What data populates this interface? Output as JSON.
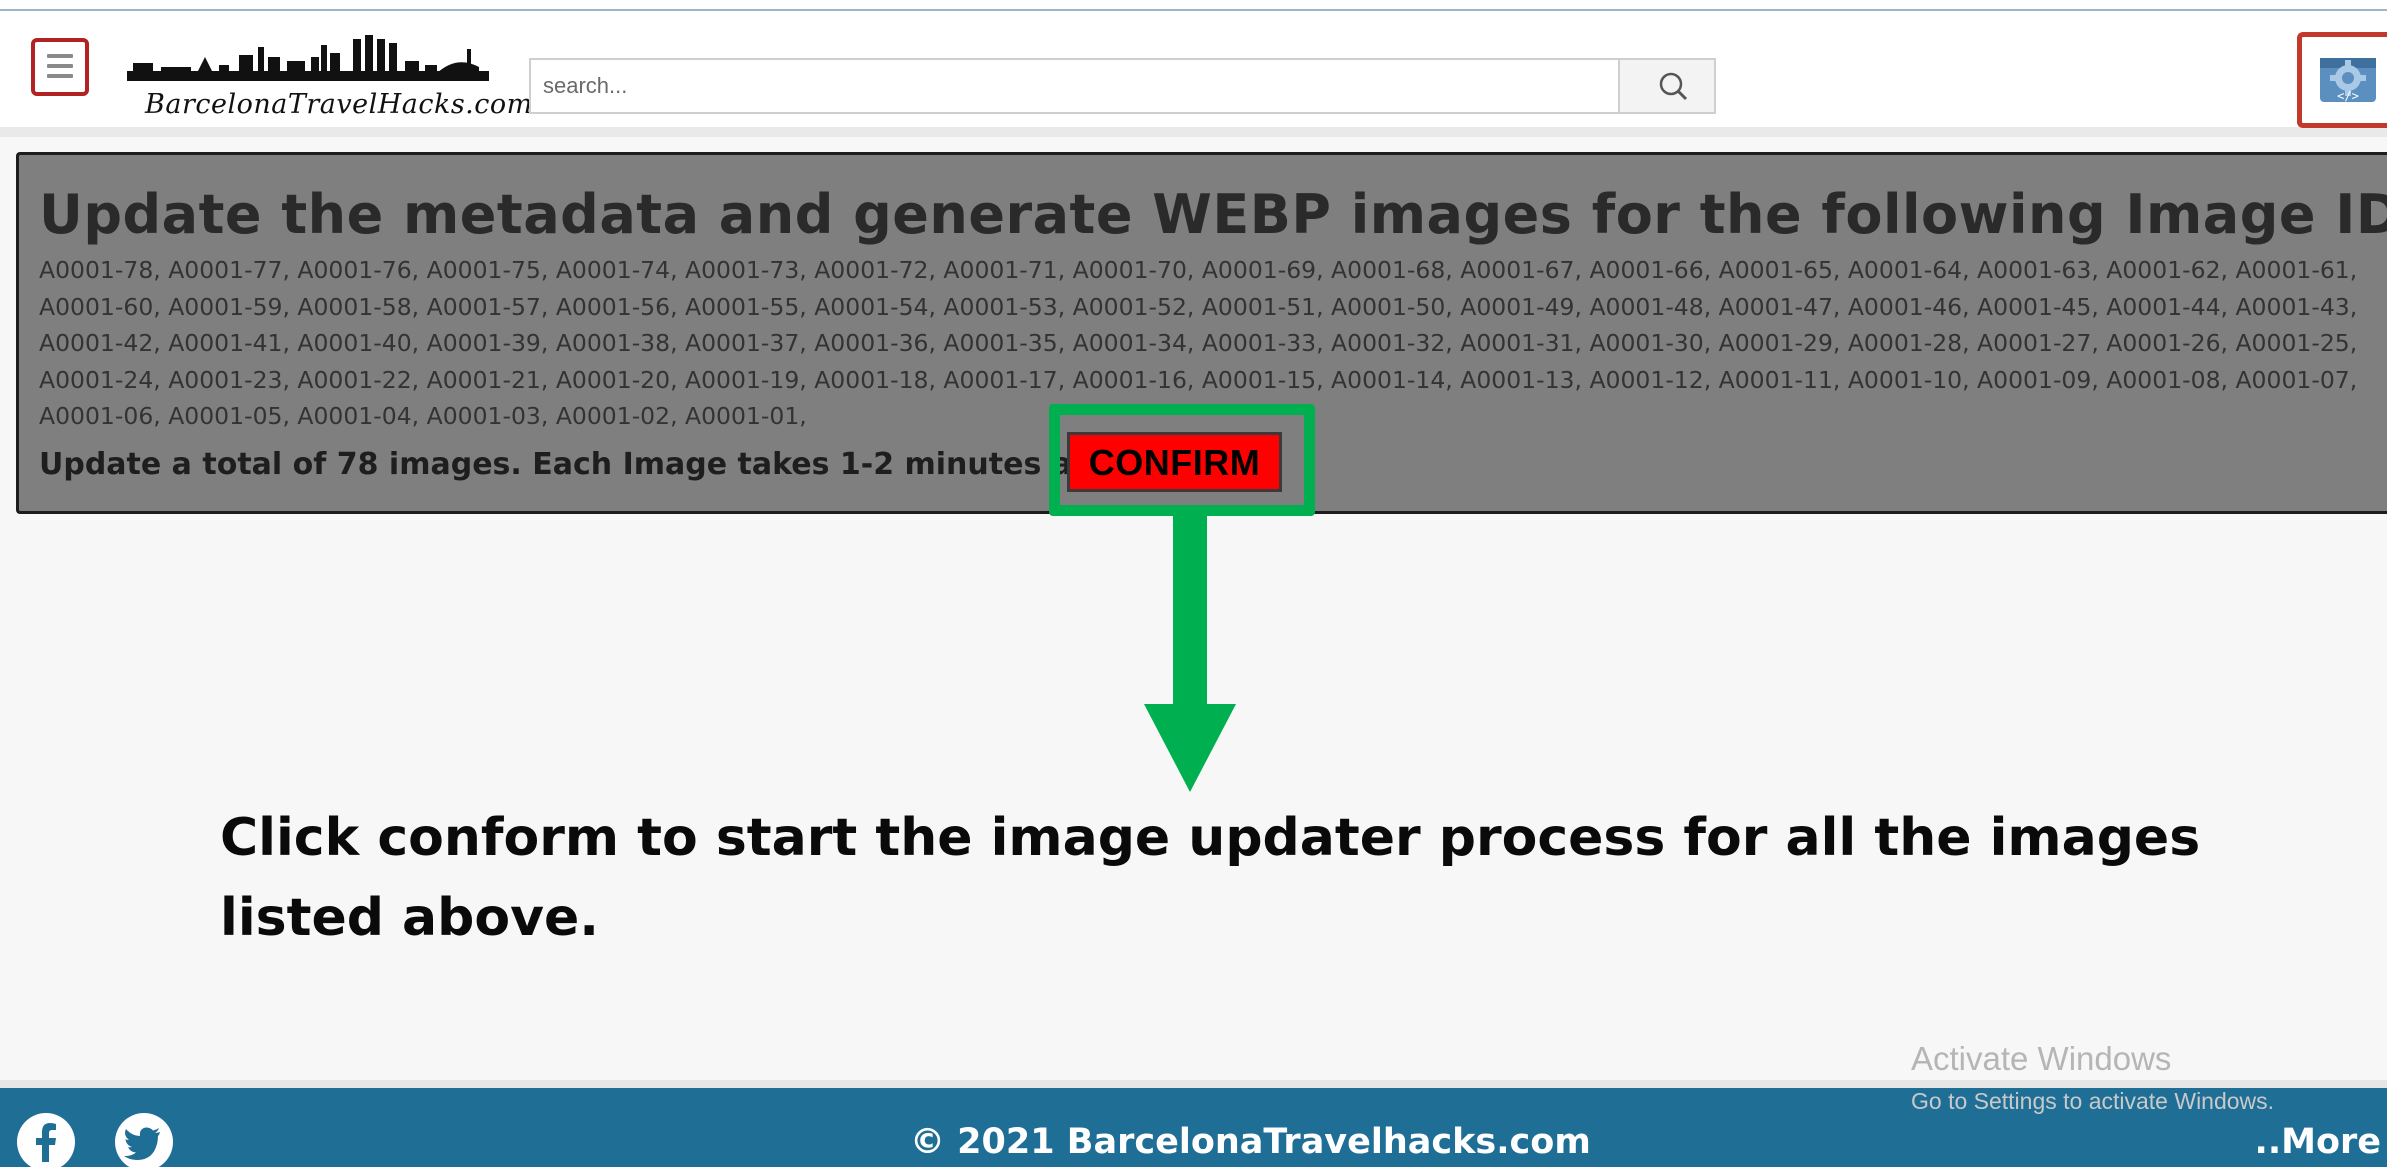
{
  "header": {
    "logo_text": "BarcelonaTravelHacks.com",
    "search": {
      "placeholder": "search..."
    }
  },
  "panel": {
    "title": "Update the metadata and generate WEBP images for the following Image IDs?",
    "image_ids": "A0001-78, A0001-77, A0001-76, A0001-75, A0001-74, A0001-73, A0001-72, A0001-71, A0001-70, A0001-69, A0001-68, A0001-67, A0001-66, A0001-65, A0001-64, A0001-63, A0001-62, A0001-61, A0001-60, A0001-59, A0001-58, A0001-57, A0001-56, A0001-55, A0001-54, A0001-53, A0001-52, A0001-51, A0001-50, A0001-49, A0001-48, A0001-47, A0001-46, A0001-45, A0001-44, A0001-43, A0001-42, A0001-41, A0001-40, A0001-39, A0001-38, A0001-37, A0001-36, A0001-35, A0001-34, A0001-33, A0001-32, A0001-31, A0001-30, A0001-29, A0001-28, A0001-27, A0001-26, A0001-25, A0001-24, A0001-23, A0001-22, A0001-21, A0001-20, A0001-19, A0001-18, A0001-17, A0001-16, A0001-15, A0001-14, A0001-13, A0001-12, A0001-11, A0001-10, A0001-09, A0001-08, A0001-07, A0001-06, A0001-05, A0001-04, A0001-03, A0001-02, A0001-01,",
    "total_text": "Update a total of 78 images. Each Image takes 1-2 minutes aprox",
    "confirm_label": "CONFIRM"
  },
  "annotation": {
    "instruction": "Click conform to start the image updater process for all the images listed above.",
    "highlight_color": "#00b050"
  },
  "watermark": {
    "line1": "Activate Windows",
    "line2": "Go to Settings to activate Windows."
  },
  "footer": {
    "copyright": "© 2021 BarcelonaTravelhacks.com",
    "more_label": "..More",
    "background_color": "#1f6e96"
  },
  "icons": {
    "menu": "hamburger-menu-icon",
    "search": "search-icon",
    "admin": "admin-code-icon",
    "facebook": "facebook-icon",
    "twitter": "twitter-icon"
  },
  "colors": {
    "confirm_button": "#ff0000",
    "panel_background": "#7f7f7f",
    "menu_border": "#b22222"
  }
}
